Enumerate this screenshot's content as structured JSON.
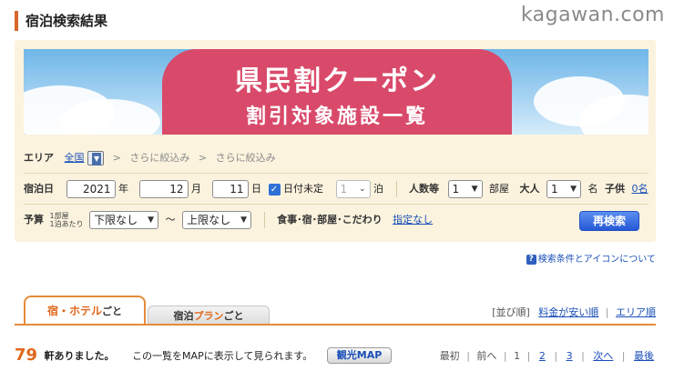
{
  "header": {
    "title": "宿泊検索結果",
    "site_mark": "kagawan.com"
  },
  "banner": {
    "line1": "県民割クーポン",
    "line2": "割引対象施設一覧"
  },
  "area_row": {
    "label": "エリア",
    "selected": "全国",
    "step1": "さらに絞込み",
    "step2": "さらに絞込み",
    "chevron": ">"
  },
  "date_row": {
    "label": "宿泊日",
    "year": "2021",
    "year_unit": "年",
    "month": "12",
    "month_unit": "月",
    "day": "11",
    "day_unit": "日",
    "undecided_label": "日付未定",
    "nights": "1",
    "nights_unit": "泊",
    "rooms_label": "人数等",
    "rooms": "1",
    "rooms_unit": "部屋",
    "adults_label": "大人",
    "adults": "1",
    "adults_unit": "名",
    "children_label": "子供",
    "children_value": "0名"
  },
  "budget_row": {
    "label": "予算",
    "per_room_line1": "1部屋",
    "per_room_line2": "1泊あたり",
    "min": "下限なし",
    "tilde": "〜",
    "max": "上限なし",
    "conditions_label": "食事･宿･部屋･こだわり",
    "conditions_value": "指定なし",
    "search_button": "再検索"
  },
  "help": {
    "label": "検索条件とアイコンについて"
  },
  "tabs": {
    "active_main": "宿・ホテル",
    "active_suffix": "ごと",
    "inactive_prefix": "宿泊",
    "inactive_accent": "プラン",
    "inactive_suffix": "ごと"
  },
  "sort": {
    "label": "[並び順]",
    "option1": "料金が安い順",
    "option2": "エリア順"
  },
  "results": {
    "count": "79",
    "count_suffix": "軒ありました。",
    "map_text": "この一覧をMAPに表示して見られます。",
    "map_button": "観光MAP"
  },
  "pager": {
    "first": "最初",
    "prev": "前へ",
    "current": "1",
    "page2": "2",
    "page3": "3",
    "next": "次へ",
    "last": "最後"
  },
  "colors": {
    "accent_orange": "#e0681c",
    "link_blue": "#1a4fb8",
    "panel_bg": "#fbf3de",
    "banner_pink": "#d94a6a",
    "button_blue": "#2559d6"
  }
}
